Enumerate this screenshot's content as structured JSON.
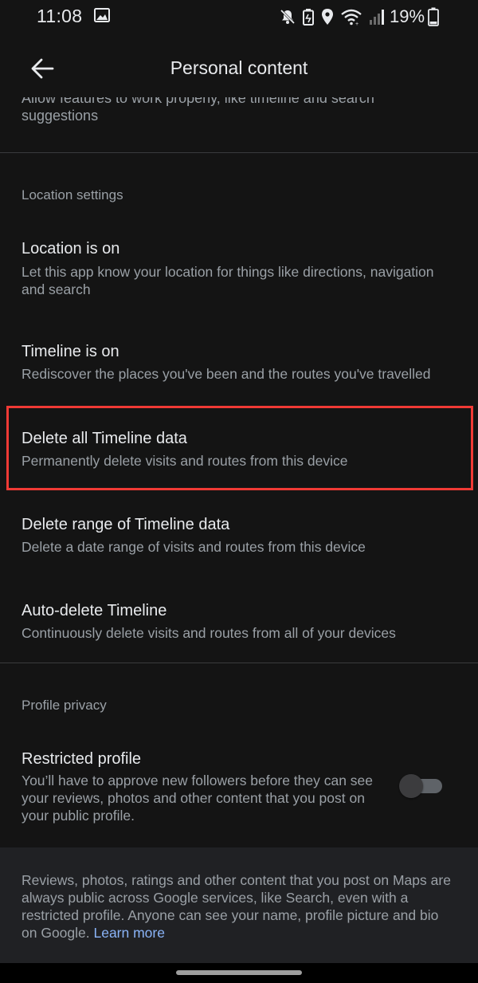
{
  "status_bar": {
    "time": "11:08",
    "battery_percent": "19%",
    "icons": [
      "image-icon",
      "mute-icon",
      "battery-saver-icon",
      "location-icon",
      "wifi-icon",
      "signal-icon",
      "battery-icon"
    ]
  },
  "app_bar": {
    "title": "Personal content",
    "back_icon": "arrow-back-icon"
  },
  "cutoff_item": {
    "line1": "Allow features to work properly, like timeline and search",
    "line2": "suggestions"
  },
  "location_section": {
    "header": "Location settings",
    "items": [
      {
        "title": "Location is on",
        "description": "Let this app know your location for things like directions, navigation and search"
      },
      {
        "title": "Timeline is on",
        "description": "Rediscover the places you've been and the routes you've travelled"
      },
      {
        "title": "Delete all Timeline data",
        "description": "Permanently delete visits and routes from this device"
      },
      {
        "title": "Delete range of Timeline data",
        "description": "Delete a date range of visits and routes from this device"
      },
      {
        "title": "Auto-delete Timeline",
        "description": "Continuously delete visits and routes from all of your devices"
      }
    ]
  },
  "profile_section": {
    "header": "Profile privacy",
    "restricted_profile": {
      "title": "Restricted profile",
      "description": "You’ll have to approve new followers before they can see your reviews, photos and other content that you post on your public profile.",
      "toggle_on": false
    }
  },
  "info_panel": {
    "text": "Reviews, photos, ratings and other content that you post on Maps are always public across Google services, like Search, even with a restricted profile. Anyone can see your name, profile picture and bio on Google.",
    "link": "Learn more"
  },
  "colors": {
    "background": "#141414",
    "primary_text": "#e8eaed",
    "secondary_text": "#9aa0a6",
    "link": "#8ab4f8",
    "highlight": "#f03a35",
    "panel": "#202124"
  }
}
